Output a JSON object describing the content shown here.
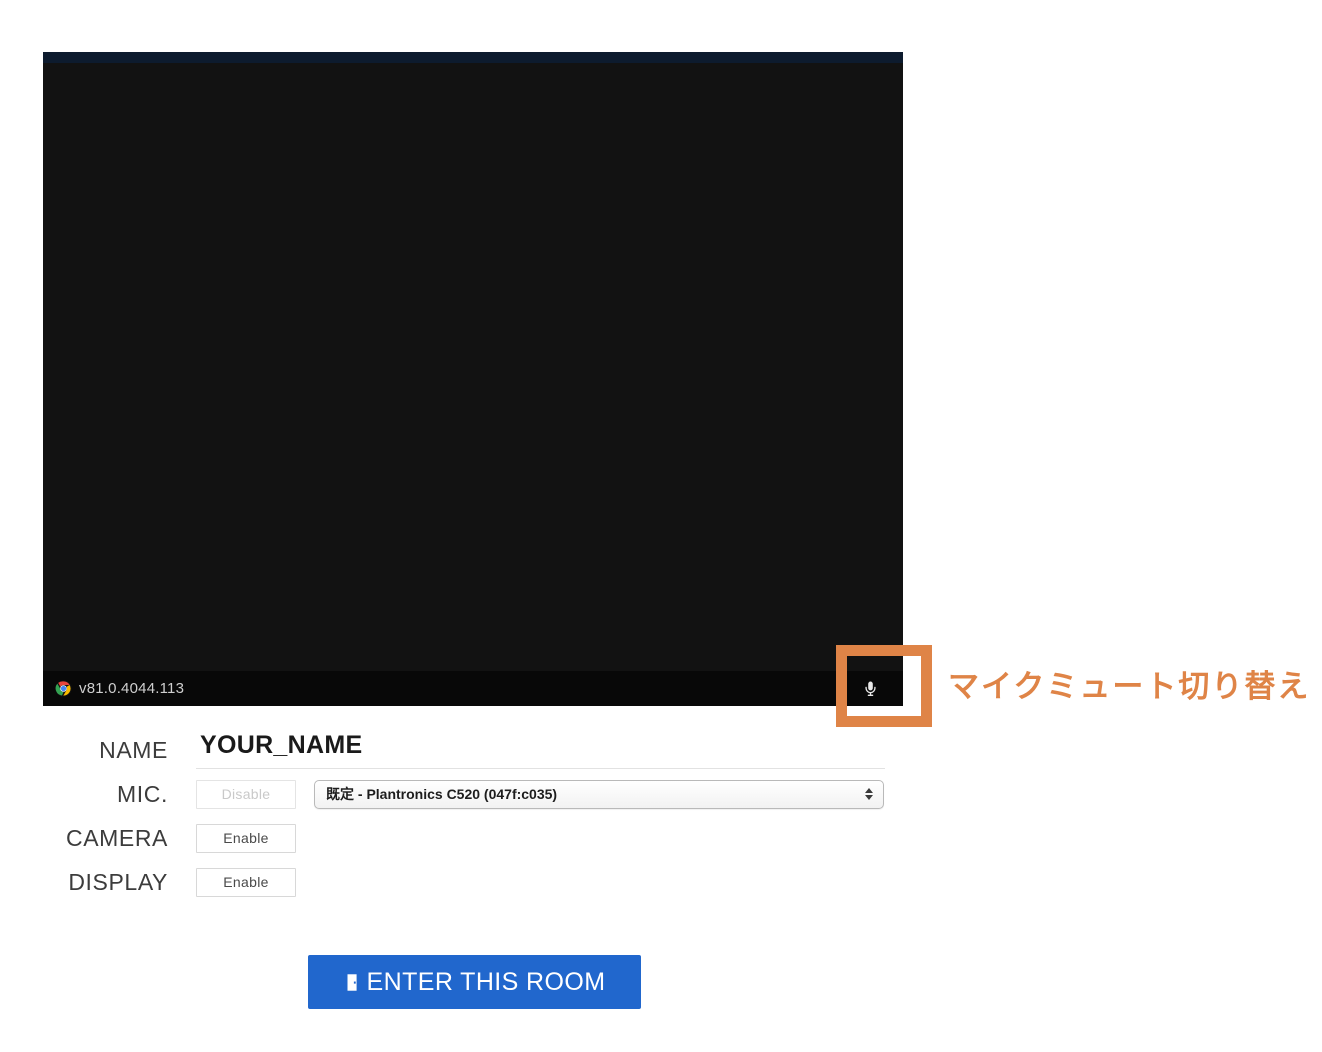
{
  "video_panel": {
    "toolbar": {
      "chrome_icon": "chrome-logo-icon",
      "version_text": "v81.0.4044.113",
      "mic_button": {
        "icon": "microphone-icon",
        "title": "Toggle microphone mute"
      }
    }
  },
  "annotation": {
    "text": "マイクミュート切り替え",
    "color": "#df8447",
    "target": "mic-toggle-button"
  },
  "form": {
    "rows": [
      {
        "label": "NAME",
        "control": "text-input",
        "value": "YOUR_NAME",
        "placeholder": "YOUR_NAME"
      },
      {
        "label": "MIC.",
        "control": "toggle-and-select",
        "button_label": "Disable",
        "button_disabled": true,
        "device_value": "既定 - Plantronics C520 (047f:c035)"
      },
      {
        "label": "CAMERA",
        "control": "toggle",
        "button_label": "Enable",
        "button_disabled": false
      },
      {
        "label": "DISPLAY",
        "control": "toggle",
        "button_label": "Enable",
        "button_disabled": false
      }
    ]
  },
  "enter_room": {
    "label": "ENTER THIS ROOM",
    "icon": "door-enter-icon",
    "color": "#2167cd"
  }
}
